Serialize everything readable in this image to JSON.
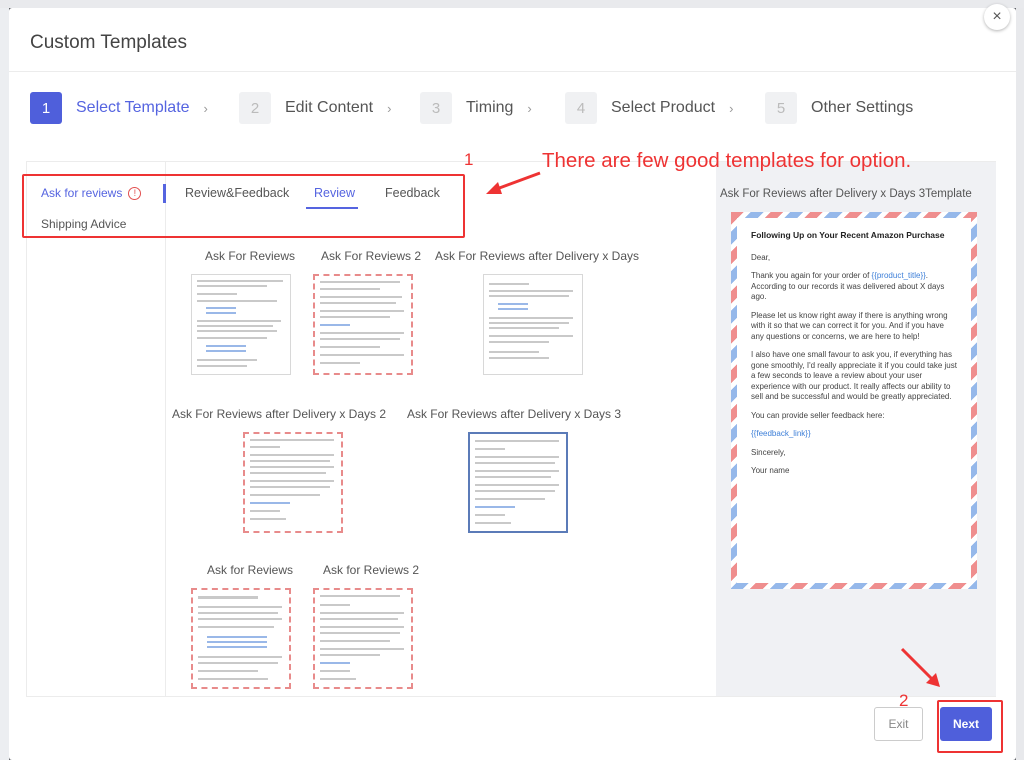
{
  "modal": {
    "title": "Custom Templates",
    "close_glyph": "×"
  },
  "steps": [
    {
      "num": "1",
      "label": "Select Template"
    },
    {
      "num": "2",
      "label": "Edit Content"
    },
    {
      "num": "3",
      "label": "Timing"
    },
    {
      "num": "4",
      "label": "Select Product"
    },
    {
      "num": "5",
      "label": "Other Settings"
    }
  ],
  "step_chevron": "›",
  "categories": {
    "active": "Ask for reviews",
    "active_alert": "!",
    "other": "Shipping Advice"
  },
  "tabs": [
    "Review&Feedback",
    "Review",
    "Feedback"
  ],
  "templates": [
    "Ask For Reviews",
    "Ask For Reviews 2",
    "Ask For Reviews after Delivery x Days",
    "Ask For Reviews after Delivery x Days 2",
    "Ask For Reviews after Delivery x Days 3",
    "Ask for Reviews",
    "Ask for Reviews 2"
  ],
  "preview": {
    "title": "Ask For Reviews after Delivery x Days 3Template",
    "heading": "Following Up on Your Recent Amazon Purchase",
    "greeting": "Dear,",
    "p1_a": "Thank you again for your order of ",
    "p1_ph": "{{product_title}}",
    "p1_b": ". According to our records it was delivered about X days ago.",
    "p2": "Please let us know right away if there is anything wrong with it so that we can correct it for you. And if you have any questions or concerns, we are here to help!",
    "p3": "I also have one small favour to ask you, if everything has gone smoothly, I'd really appreciate it if you could take just a few seconds to leave a review about your user experience with our product. It really affects our ability to sell and be successful and would be greatly appreciated.",
    "p4": "You can provide seller feedback here:",
    "p5_ph": "{{feedback_link}}",
    "closing": "Sincerely,",
    "signature": "Your name"
  },
  "annotations": {
    "num1": "1",
    "note": "There are few good templates for option.",
    "num2": "2"
  },
  "buttons": {
    "exit": "Exit",
    "next": "Next"
  },
  "colors": {
    "accent": "#4f5fdb",
    "annotation": "#e33333",
    "airmail_red": "#ef8e8e",
    "airmail_blue": "#95b8ea"
  }
}
